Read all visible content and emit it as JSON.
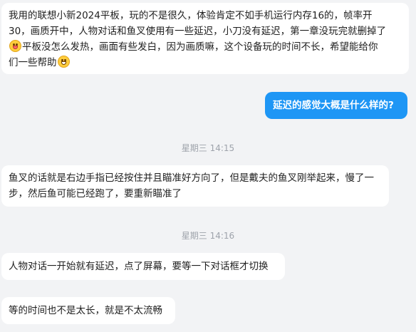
{
  "messages": [
    {
      "direction": "in",
      "line1": "我用的联想小新2024平板，玩的不是很久，体验肯定不如手机运行内存16的，帧率开",
      "line2": "30，画质开中，人物对话和鱼叉使用有一些延迟，小刀没有延迟，第一章没玩完就删掉了",
      "line3": "平板没怎么发热，画面有些发白，因为画质嘛，这个设备玩的时间不长，希望能给你",
      "line4": "们一些帮助",
      "emoji1": "savoring-face-emoji",
      "emoji2": "grinning-face-emoji"
    },
    {
      "direction": "out",
      "text": "延迟的感觉大概是什么样的?"
    },
    {
      "direction": "in",
      "line1": "鱼叉的话就是右边手指已经按住并且瞄准好方向了，但是戴夫的鱼叉刚举起来，慢了一",
      "line2": "步，然后鱼可能已经跑了，要重新瞄准了"
    },
    {
      "direction": "in",
      "text": "人物对话一开始就有延迟，点了屏幕，要等一下对话框才切换"
    },
    {
      "direction": "in",
      "text": "等的时间也不是太长，就是不太流畅"
    }
  ],
  "timestamps": [
    "星期三 14:15",
    "星期三 14:16"
  ],
  "colors": {
    "background": "#f2f3f5",
    "incoming_bubble": "#ffffff",
    "outgoing_bubble": "#1e96f5",
    "timestamp_text": "#9ea3ab"
  }
}
